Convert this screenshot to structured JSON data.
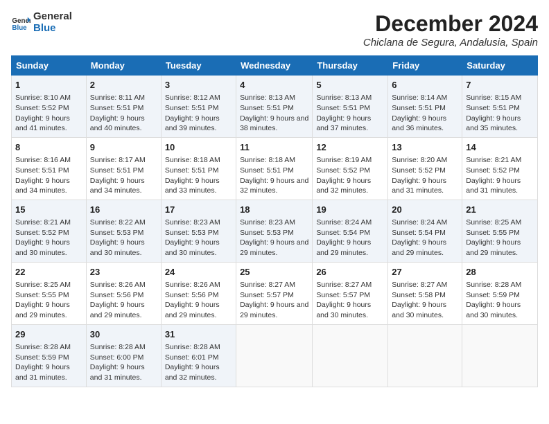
{
  "header": {
    "logo_line1": "General",
    "logo_line2": "Blue",
    "title": "December 2024",
    "subtitle": "Chiclana de Segura, Andalusia, Spain"
  },
  "days_of_week": [
    "Sunday",
    "Monday",
    "Tuesday",
    "Wednesday",
    "Thursday",
    "Friday",
    "Saturday"
  ],
  "weeks": [
    [
      {
        "day": "1",
        "sunrise": "Sunrise: 8:10 AM",
        "sunset": "Sunset: 5:52 PM",
        "daylight": "Daylight: 9 hours and 41 minutes."
      },
      {
        "day": "2",
        "sunrise": "Sunrise: 8:11 AM",
        "sunset": "Sunset: 5:51 PM",
        "daylight": "Daylight: 9 hours and 40 minutes."
      },
      {
        "day": "3",
        "sunrise": "Sunrise: 8:12 AM",
        "sunset": "Sunset: 5:51 PM",
        "daylight": "Daylight: 9 hours and 39 minutes."
      },
      {
        "day": "4",
        "sunrise": "Sunrise: 8:13 AM",
        "sunset": "Sunset: 5:51 PM",
        "daylight": "Daylight: 9 hours and 38 minutes."
      },
      {
        "day": "5",
        "sunrise": "Sunrise: 8:13 AM",
        "sunset": "Sunset: 5:51 PM",
        "daylight": "Daylight: 9 hours and 37 minutes."
      },
      {
        "day": "6",
        "sunrise": "Sunrise: 8:14 AM",
        "sunset": "Sunset: 5:51 PM",
        "daylight": "Daylight: 9 hours and 36 minutes."
      },
      {
        "day": "7",
        "sunrise": "Sunrise: 8:15 AM",
        "sunset": "Sunset: 5:51 PM",
        "daylight": "Daylight: 9 hours and 35 minutes."
      }
    ],
    [
      {
        "day": "8",
        "sunrise": "Sunrise: 8:16 AM",
        "sunset": "Sunset: 5:51 PM",
        "daylight": "Daylight: 9 hours and 34 minutes."
      },
      {
        "day": "9",
        "sunrise": "Sunrise: 8:17 AM",
        "sunset": "Sunset: 5:51 PM",
        "daylight": "Daylight: 9 hours and 34 minutes."
      },
      {
        "day": "10",
        "sunrise": "Sunrise: 8:18 AM",
        "sunset": "Sunset: 5:51 PM",
        "daylight": "Daylight: 9 hours and 33 minutes."
      },
      {
        "day": "11",
        "sunrise": "Sunrise: 8:18 AM",
        "sunset": "Sunset: 5:51 PM",
        "daylight": "Daylight: 9 hours and 32 minutes."
      },
      {
        "day": "12",
        "sunrise": "Sunrise: 8:19 AM",
        "sunset": "Sunset: 5:52 PM",
        "daylight": "Daylight: 9 hours and 32 minutes."
      },
      {
        "day": "13",
        "sunrise": "Sunrise: 8:20 AM",
        "sunset": "Sunset: 5:52 PM",
        "daylight": "Daylight: 9 hours and 31 minutes."
      },
      {
        "day": "14",
        "sunrise": "Sunrise: 8:21 AM",
        "sunset": "Sunset: 5:52 PM",
        "daylight": "Daylight: 9 hours and 31 minutes."
      }
    ],
    [
      {
        "day": "15",
        "sunrise": "Sunrise: 8:21 AM",
        "sunset": "Sunset: 5:52 PM",
        "daylight": "Daylight: 9 hours and 30 minutes."
      },
      {
        "day": "16",
        "sunrise": "Sunrise: 8:22 AM",
        "sunset": "Sunset: 5:53 PM",
        "daylight": "Daylight: 9 hours and 30 minutes."
      },
      {
        "day": "17",
        "sunrise": "Sunrise: 8:23 AM",
        "sunset": "Sunset: 5:53 PM",
        "daylight": "Daylight: 9 hours and 30 minutes."
      },
      {
        "day": "18",
        "sunrise": "Sunrise: 8:23 AM",
        "sunset": "Sunset: 5:53 PM",
        "daylight": "Daylight: 9 hours and 29 minutes."
      },
      {
        "day": "19",
        "sunrise": "Sunrise: 8:24 AM",
        "sunset": "Sunset: 5:54 PM",
        "daylight": "Daylight: 9 hours and 29 minutes."
      },
      {
        "day": "20",
        "sunrise": "Sunrise: 8:24 AM",
        "sunset": "Sunset: 5:54 PM",
        "daylight": "Daylight: 9 hours and 29 minutes."
      },
      {
        "day": "21",
        "sunrise": "Sunrise: 8:25 AM",
        "sunset": "Sunset: 5:55 PM",
        "daylight": "Daylight: 9 hours and 29 minutes."
      }
    ],
    [
      {
        "day": "22",
        "sunrise": "Sunrise: 8:25 AM",
        "sunset": "Sunset: 5:55 PM",
        "daylight": "Daylight: 9 hours and 29 minutes."
      },
      {
        "day": "23",
        "sunrise": "Sunrise: 8:26 AM",
        "sunset": "Sunset: 5:56 PM",
        "daylight": "Daylight: 9 hours and 29 minutes."
      },
      {
        "day": "24",
        "sunrise": "Sunrise: 8:26 AM",
        "sunset": "Sunset: 5:56 PM",
        "daylight": "Daylight: 9 hours and 29 minutes."
      },
      {
        "day": "25",
        "sunrise": "Sunrise: 8:27 AM",
        "sunset": "Sunset: 5:57 PM",
        "daylight": "Daylight: 9 hours and 29 minutes."
      },
      {
        "day": "26",
        "sunrise": "Sunrise: 8:27 AM",
        "sunset": "Sunset: 5:57 PM",
        "daylight": "Daylight: 9 hours and 30 minutes."
      },
      {
        "day": "27",
        "sunrise": "Sunrise: 8:27 AM",
        "sunset": "Sunset: 5:58 PM",
        "daylight": "Daylight: 9 hours and 30 minutes."
      },
      {
        "day": "28",
        "sunrise": "Sunrise: 8:28 AM",
        "sunset": "Sunset: 5:59 PM",
        "daylight": "Daylight: 9 hours and 30 minutes."
      }
    ],
    [
      {
        "day": "29",
        "sunrise": "Sunrise: 8:28 AM",
        "sunset": "Sunset: 5:59 PM",
        "daylight": "Daylight: 9 hours and 31 minutes."
      },
      {
        "day": "30",
        "sunrise": "Sunrise: 8:28 AM",
        "sunset": "Sunset: 6:00 PM",
        "daylight": "Daylight: 9 hours and 31 minutes."
      },
      {
        "day": "31",
        "sunrise": "Sunrise: 8:28 AM",
        "sunset": "Sunset: 6:01 PM",
        "daylight": "Daylight: 9 hours and 32 minutes."
      },
      null,
      null,
      null,
      null
    ]
  ]
}
